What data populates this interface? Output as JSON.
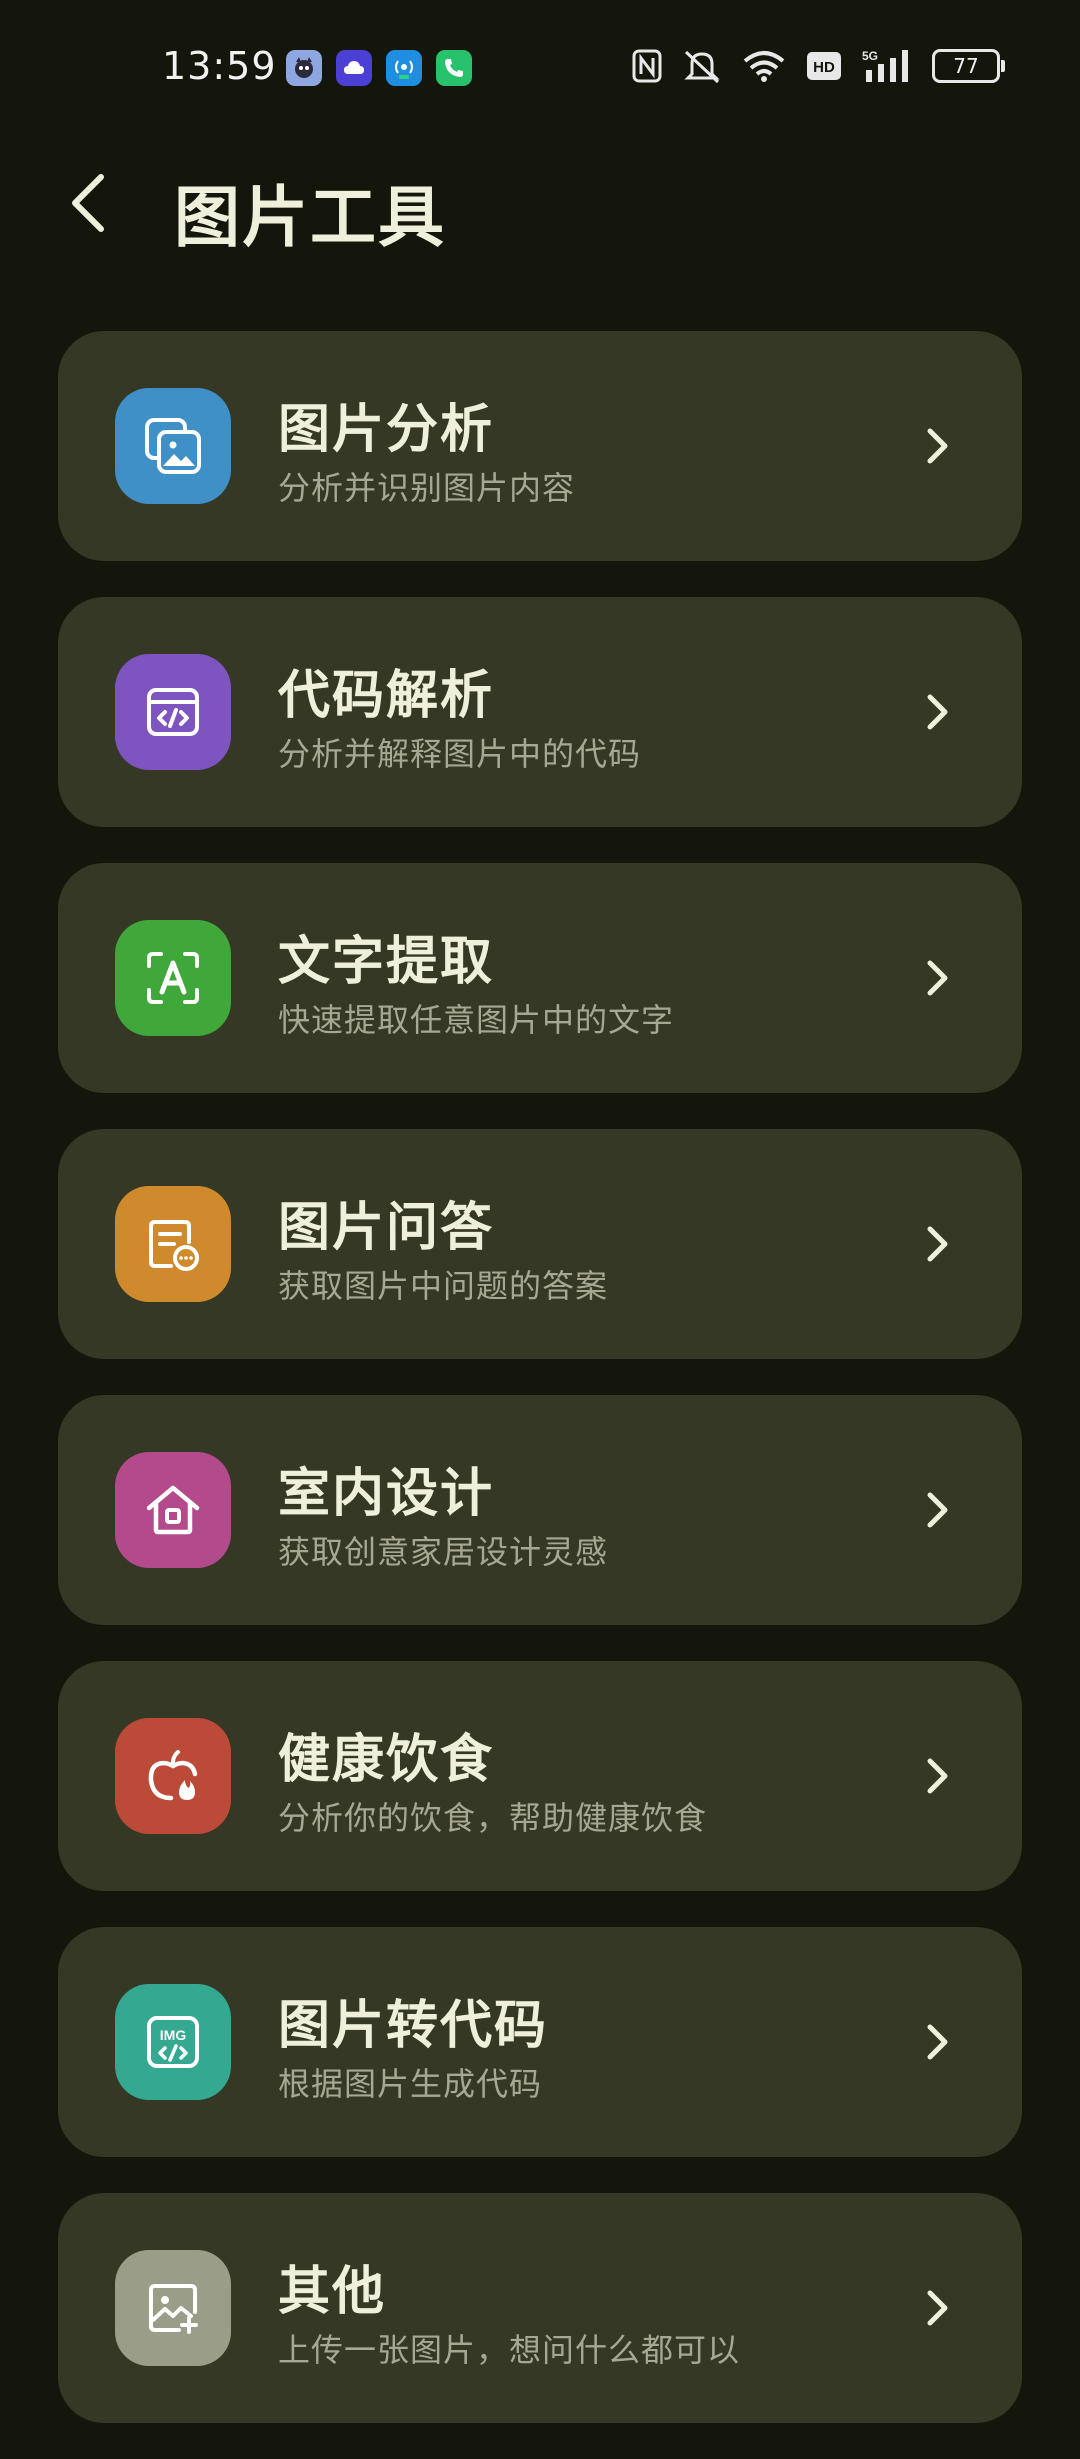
{
  "status_bar": {
    "time": "13:59",
    "battery": "77",
    "network": "5G",
    "hd": "HD",
    "app_icons": [
      "cat-app-icon",
      "cloud-app-icon",
      "signal-app-icon",
      "phone-app-icon"
    ]
  },
  "header": {
    "title": "图片工具"
  },
  "tools": [
    {
      "title": "图片分析",
      "subtitle": "分析并识别图片内容",
      "color": "#3f90c7",
      "icon": "image-gallery-icon"
    },
    {
      "title": "代码解析",
      "subtitle": "分析并解释图片中的代码",
      "color": "#7e55c0",
      "icon": "code-window-icon"
    },
    {
      "title": "文字提取",
      "subtitle": "快速提取任意图片中的文字",
      "color": "#40a73b",
      "icon": "text-scan-icon"
    },
    {
      "title": "图片问答",
      "subtitle": "获取图片中问题的答案",
      "color": "#d08a2e",
      "icon": "document-chat-icon"
    },
    {
      "title": "室内设计",
      "subtitle": "获取创意家居设计灵感",
      "color": "#b24a8c",
      "icon": "house-icon"
    },
    {
      "title": "健康饮食",
      "subtitle": "分析你的饮食，帮助健康饮食",
      "color": "#bb4b38",
      "icon": "apple-fire-icon"
    },
    {
      "title": "图片转代码",
      "subtitle": "根据图片生成代码",
      "color": "#34a890",
      "icon": "img-code-icon"
    },
    {
      "title": "其他",
      "subtitle": "上传一张图片，想问什么都可以",
      "color": "#9a9d88",
      "icon": "image-add-icon"
    }
  ]
}
